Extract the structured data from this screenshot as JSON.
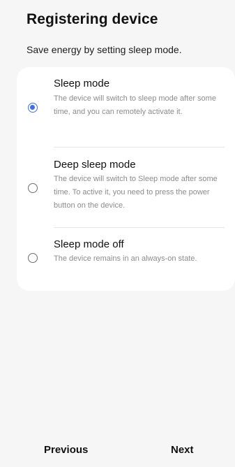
{
  "header": {
    "title": "Registering device",
    "subtitle": "Save energy by setting sleep mode."
  },
  "options": [
    {
      "title": "Sleep mode",
      "description": "The device will switch to sleep mode after some time, and you can remotely activate it.",
      "selected": true
    },
    {
      "title": "Deep sleep mode",
      "description": "The device will switch to Sleep mode after some time. To active it, you need to press the power button on the device.",
      "selected": false
    },
    {
      "title": "Sleep mode off",
      "description": "The device remains in an always-on state.",
      "selected": false
    }
  ],
  "footer": {
    "previous_label": "Previous",
    "next_label": "Next"
  },
  "colors": {
    "accent": "#3e6fe6",
    "background": "#f6f6f7",
    "card": "#ffffff"
  }
}
